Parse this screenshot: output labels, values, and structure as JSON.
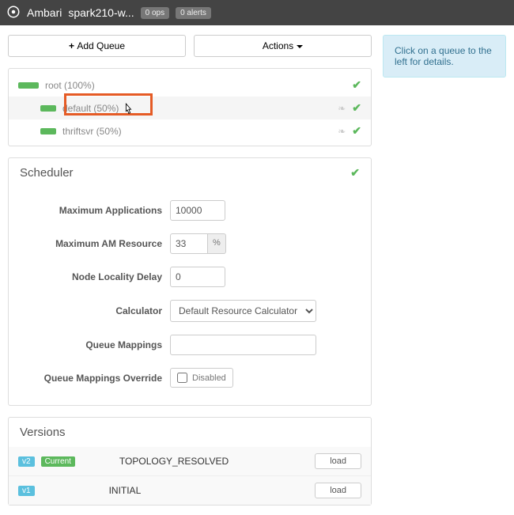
{
  "header": {
    "brand": "Ambari",
    "cluster": "spark210-w...",
    "ops_badge": "0 ops",
    "alerts_badge": "0 alerts"
  },
  "buttons": {
    "add_queue": "Add Queue",
    "actions": "Actions"
  },
  "queues": {
    "root": {
      "label": "root (100%)"
    },
    "default": {
      "label": "default (50%)"
    },
    "thriftsvr": {
      "label": "thriftsvr (50%)"
    }
  },
  "scheduler": {
    "title": "Scheduler",
    "labels": {
      "max_apps": "Maximum Applications",
      "max_am": "Maximum AM Resource",
      "node_locality": "Node Locality Delay",
      "calculator": "Calculator",
      "queue_mappings": "Queue Mappings",
      "queue_mappings_override": "Queue Mappings Override"
    },
    "values": {
      "max_apps": "10000",
      "max_am": "33",
      "pct": "%",
      "node_locality": "0",
      "calculator": "Default Resource Calculator",
      "queue_mappings": "",
      "override_label": "Disabled"
    }
  },
  "versions": {
    "title": "Versions",
    "load_label": "load",
    "rows": [
      {
        "badge": "v2",
        "current": "Current",
        "status": "TOPOLOGY_RESOLVED"
      },
      {
        "badge": "v1",
        "current": "",
        "status": "INITIAL"
      }
    ]
  },
  "info": {
    "message": "Click on a queue to the left for details."
  }
}
